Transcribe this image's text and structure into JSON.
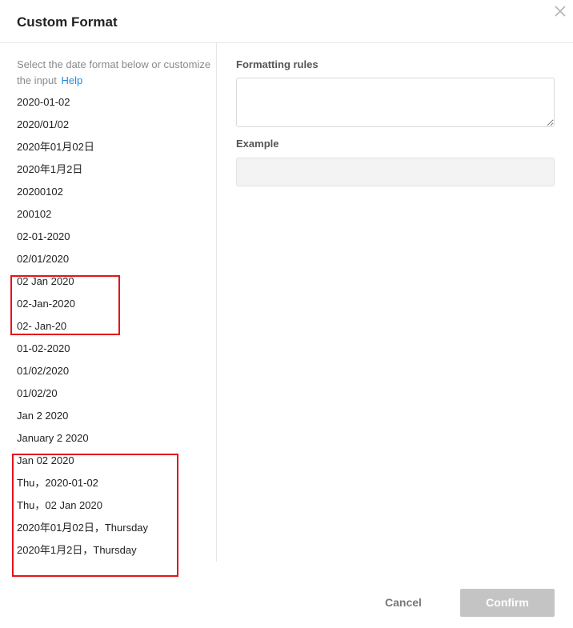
{
  "dialog": {
    "title": "Custom Format",
    "close_icon": "close-icon"
  },
  "left_panel": {
    "hint": "Select the date format below or customize the input",
    "help_link": "Help",
    "formats": [
      "2020-01-02",
      "2020/01/02",
      "2020年01月02日",
      "2020年1月2日",
      "20200102",
      "200102",
      "02-01-2020",
      "02/01/2020",
      "02 Jan 2020",
      "02-Jan-2020",
      "02- Jan-20",
      "01-02-2020",
      "01/02/2020",
      "01/02/20",
      "Jan 2 2020",
      "January 2 2020",
      "Jan 02 2020",
      "Thu，2020-01-02",
      "Thu，02 Jan 2020",
      "2020年01月02日，Thursday",
      "2020年1月2日，Thursday"
    ]
  },
  "right_panel": {
    "rules_label": "Formatting rules",
    "rules_value": "",
    "example_label": "Example",
    "example_value": ""
  },
  "footer": {
    "cancel_label": "Cancel",
    "confirm_label": "Confirm"
  },
  "colors": {
    "highlight_border": "#e3131b",
    "help_link": "#1a8cdd",
    "confirm_disabled_bg": "#c4c4c4"
  }
}
